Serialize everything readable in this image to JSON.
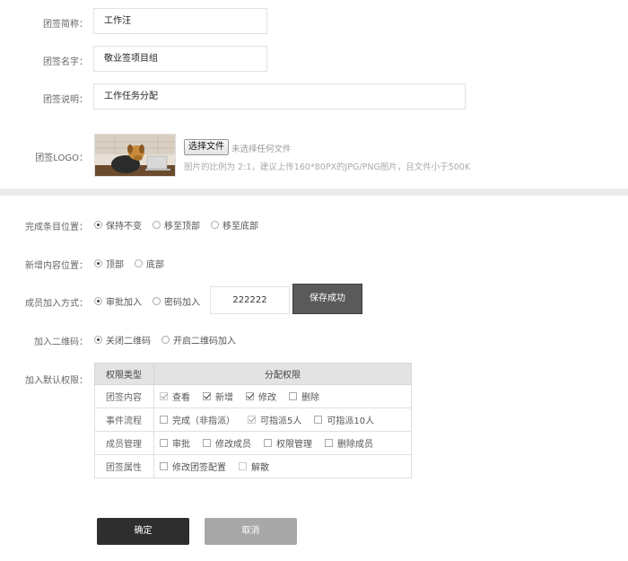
{
  "basic": {
    "abbr_label": "团签简称：",
    "abbr_value": "工作汪",
    "name_label": "团签名字：",
    "name_value": "敬业签项目组",
    "desc_label": "团签说明：",
    "desc_value": "工作任务分配",
    "logo_label": "团签LOGO：",
    "file_button": "选择文件",
    "file_status": "未选择任何文件",
    "logo_hint": "图片的比例为 2:1，建议上传160*80PX的JPG/PNG图片，且文件小于500K"
  },
  "settings": {
    "complete_pos": {
      "label": "完成条目位置：",
      "options": [
        "保持不变",
        "移至顶部",
        "移至底部"
      ],
      "selected": 0
    },
    "new_pos": {
      "label": "新增内容位置：",
      "options": [
        "顶部",
        "底部"
      ],
      "selected": 0
    },
    "join_mode": {
      "label": "成员加入方式：",
      "options": [
        "审批加入",
        "密码加入"
      ],
      "selected": 0,
      "password": "222222",
      "save_label": "保存成功"
    },
    "qrcode": {
      "label": "加入二维码：",
      "options": [
        "关闭二维码",
        "开启二维码加入"
      ],
      "selected": 0
    }
  },
  "permissions": {
    "label": "加入默认权限：",
    "headers": [
      "权限类型",
      "分配权限"
    ],
    "rows": [
      {
        "type": "团签内容",
        "items": [
          {
            "label": "查看",
            "checked": true,
            "disabled": true
          },
          {
            "label": "新增",
            "checked": true,
            "disabled": false
          },
          {
            "label": "修改",
            "checked": true,
            "disabled": false
          },
          {
            "label": "删除",
            "checked": false,
            "disabled": false
          }
        ]
      },
      {
        "type": "事件流程",
        "items": [
          {
            "label": "完成（非指派）",
            "checked": false,
            "disabled": false
          },
          {
            "label": "可指派5人",
            "checked": true,
            "disabled": true
          },
          {
            "label": "可指派10人",
            "checked": false,
            "disabled": false
          }
        ]
      },
      {
        "type": "成员管理",
        "items": [
          {
            "label": "审批",
            "checked": false,
            "disabled": false
          },
          {
            "label": "修改成员",
            "checked": false,
            "disabled": false
          },
          {
            "label": "权限管理",
            "checked": false,
            "disabled": false
          },
          {
            "label": "删除成员",
            "checked": false,
            "disabled": false
          }
        ]
      },
      {
        "type": "团签属性",
        "items": [
          {
            "label": "修改团签配置",
            "checked": false,
            "disabled": false
          },
          {
            "label": "解散",
            "checked": false,
            "disabled": true
          }
        ]
      }
    ]
  },
  "actions": {
    "ok_label": "确定",
    "cancel_label": "取消"
  },
  "icons": {
    "logo_image": "dog-with-laptop-image"
  }
}
